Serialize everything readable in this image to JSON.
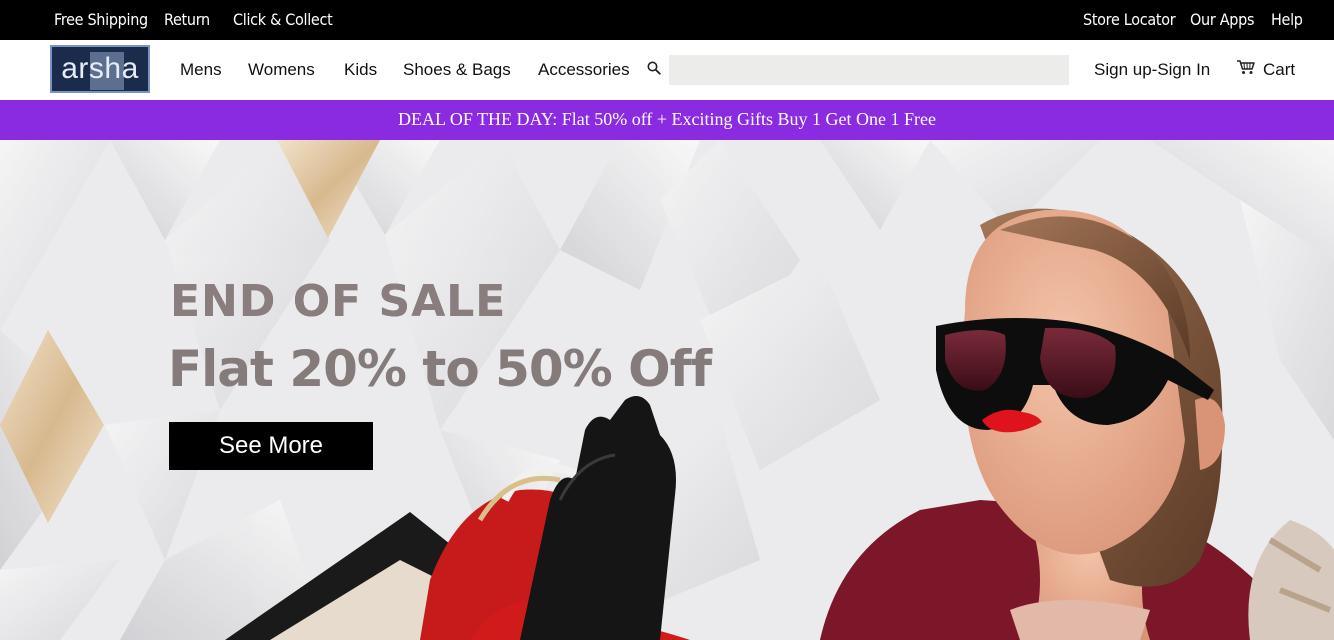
{
  "topbar": {
    "left_links": [
      "Free Shipping",
      "Return",
      "Click & Collect"
    ],
    "right_links": [
      "Store Locator",
      "Our Apps",
      "Help"
    ]
  },
  "header": {
    "logo_text": "arsha",
    "nav": [
      "Mens",
      "Womens",
      "Kids",
      "Shoes & Bags",
      "Accessories"
    ],
    "search_placeholder": "",
    "auth_link": "Sign up-Sign In",
    "cart_label": "Cart",
    "icons": [
      "search-icon",
      "cart-icon"
    ]
  },
  "deal_bar": {
    "text": "DEAL OF THE DAY: Flat 50% off + Exciting Gifts Buy 1 Get One 1 Free"
  },
  "hero": {
    "title": "END OF SALE",
    "subtitle": "Flat 20% to 50% Off",
    "button_label": "See More"
  },
  "colors": {
    "topbar_bg": "#000000",
    "deal_bg": "#8a2be2",
    "hero_text": "#857b7b",
    "button_bg": "#000000"
  }
}
